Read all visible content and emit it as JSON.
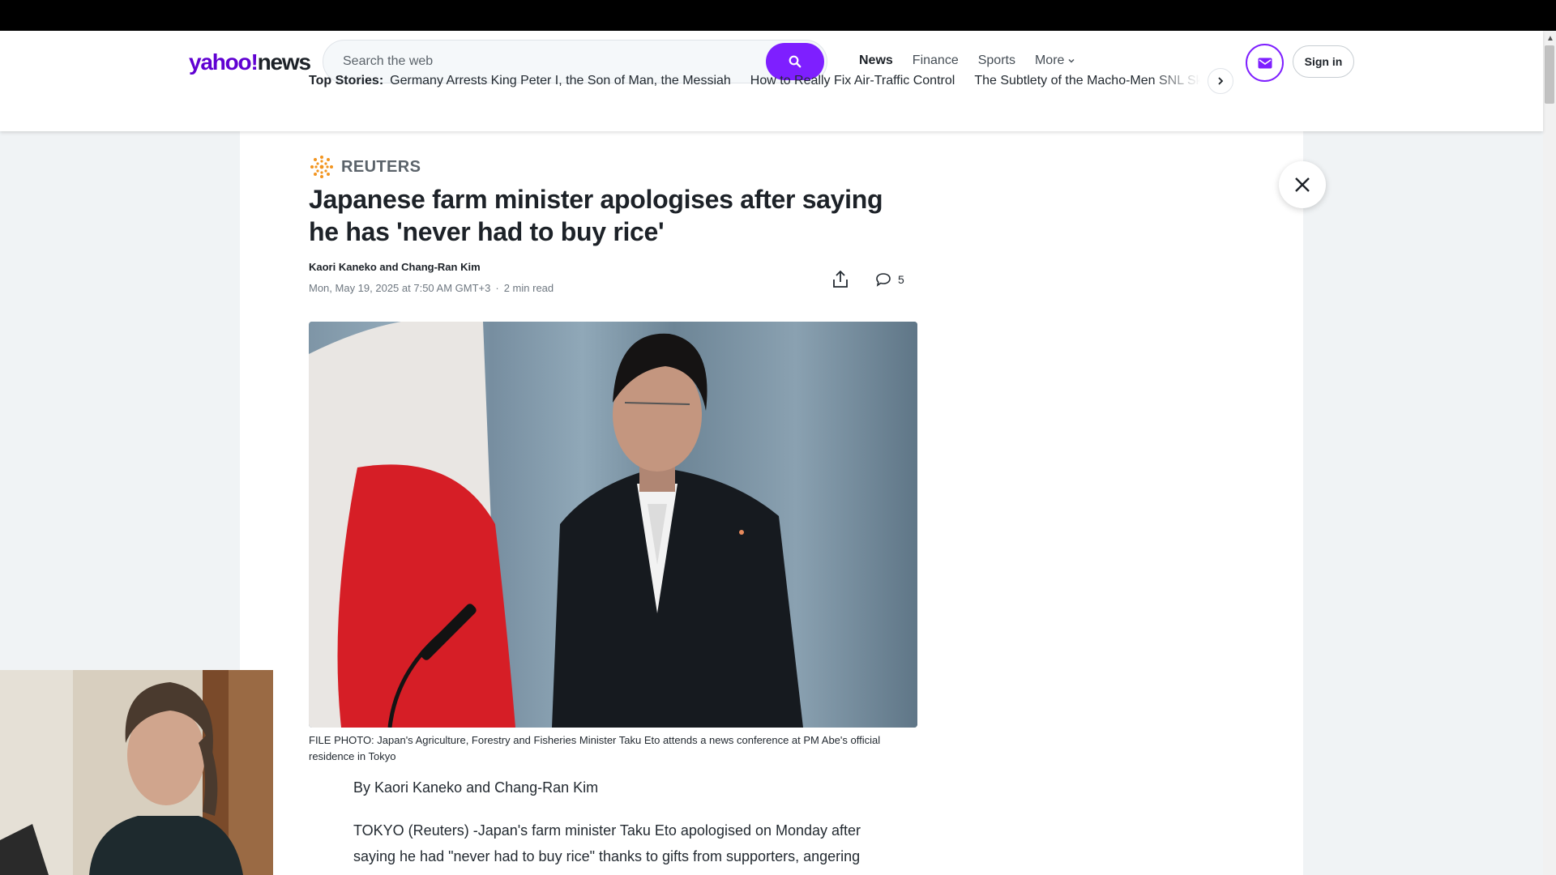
{
  "header": {
    "logo": {
      "part1": "yahoo",
      "slash": "!",
      "part2": "news"
    },
    "search": {
      "placeholder": "Search the web"
    },
    "nav": [
      {
        "label": "News",
        "active": true
      },
      {
        "label": "Finance",
        "active": false
      },
      {
        "label": "Sports",
        "active": false
      },
      {
        "label": "More",
        "active": false
      }
    ],
    "signin_label": "Sign in",
    "accent_color": "#7e1fff"
  },
  "top_stories": {
    "label": "Top Stories:",
    "items": [
      "Germany Arrests King Peter I, the Son of Man, the Messiah",
      "How to Really Fix Air-Traffic Control",
      "The Subtlety of the Macho-Men SNL Sketch"
    ]
  },
  "article": {
    "source": "REUTERS",
    "headline": "Japanese farm minister apologises after saying he has 'never had to buy rice'",
    "authors": "Kaori Kaneko and Chang-Ran Kim",
    "date": "Mon, May 19, 2025 at 7:50 AM GMT+3",
    "read_time": "2 min read",
    "comment_count": "5",
    "photo_caption": "FILE PHOTO: Japan's Agriculture, Forestry and Fisheries Minister Taku Eto attends a news conference at PM Abe's official residence in Tokyo",
    "byline": "By Kaori Kaneko and Chang-Ran Kim",
    "body": [
      "TOKYO (Reuters) -Japan's farm minister Taku Eto apologised on Monday after saying he had \"never had to buy rice\" thanks to gifts from supporters, angering"
    ]
  },
  "icons": {
    "search": "search-icon",
    "mail": "mail-icon",
    "share": "share-icon",
    "comment": "comment-icon",
    "close": "close-icon",
    "chevron_right": "chevron-right-icon",
    "chevron_down": "chevron-down-icon"
  }
}
